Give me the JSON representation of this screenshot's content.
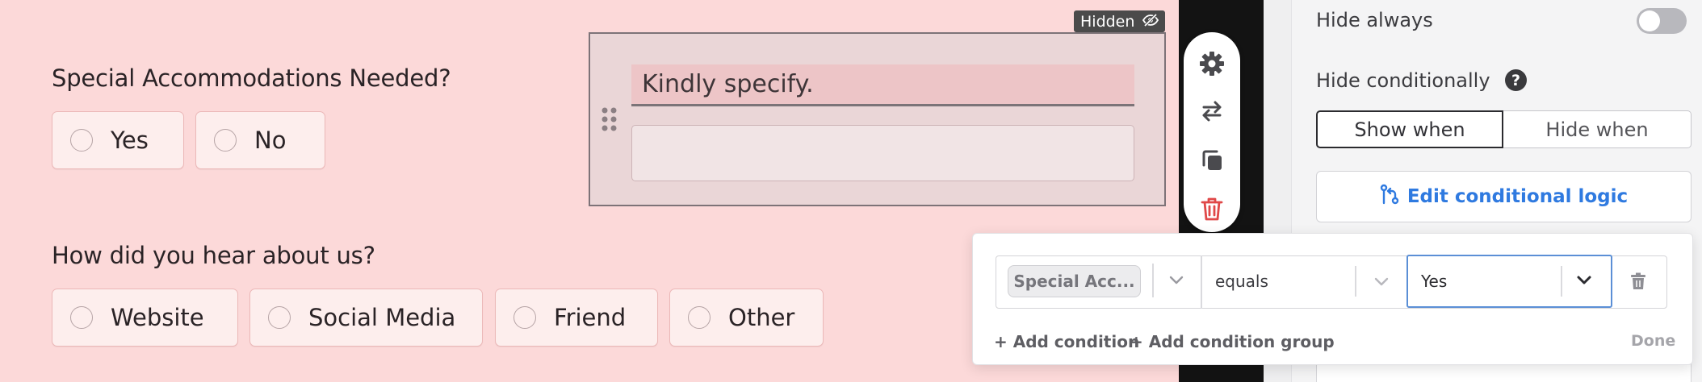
{
  "canvas": {
    "q1": {
      "title": "Special Accommodations Needed?",
      "options": [
        "Yes",
        "No"
      ]
    },
    "q2": {
      "title": "How did you hear about us?",
      "options": [
        "Website",
        "Social Media",
        "Friend",
        "Other"
      ]
    },
    "hidden_field": {
      "badge_label": "Hidden",
      "label": "Kindly specify.",
      "input_value": ""
    }
  },
  "toolbar": {
    "icons": [
      "gear-icon",
      "swap-icon",
      "duplicate-icon",
      "trash-icon"
    ],
    "danger_color": "#e04848"
  },
  "panel": {
    "hide_always_label": "Hide always",
    "hide_always_on": false,
    "hide_conditionally_label": "Hide conditionally",
    "help_icon_glyph": "?",
    "show_when_label": "Show when",
    "hide_when_label": "Hide when",
    "edit_logic_label": "Edit conditional logic",
    "accent_color": "#2f7ae0"
  },
  "popover": {
    "field_value": "Special Acc...",
    "operator_value": "equals",
    "value_value": "Yes",
    "add_condition_label": "+ Add condition",
    "add_group_label": "+ Add condition group",
    "done_label": "Done"
  }
}
